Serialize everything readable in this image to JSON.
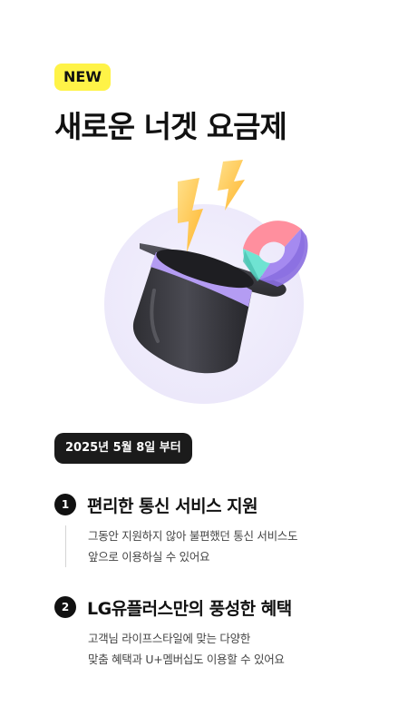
{
  "badge": "NEW",
  "title": "새로운 너겟 요금제",
  "hero": {
    "colors": {
      "circle": "#efecfb",
      "hat": "#3a3a40",
      "band": "#b49cf3",
      "bolt": "#ffc64a",
      "ring_pink": "#ff8f9e",
      "ring_mint": "#6fe3d2",
      "ring_purple": "#a58af0"
    }
  },
  "date_chip": "2025년 5월 8일 부터",
  "features": [
    {
      "number": "1",
      "title": "편리한 통신 서비스 지원",
      "lines": [
        "그동안 지원하지 않아 불편했던 통신 서비스도",
        "앞으로 이용하실 수 있어요"
      ]
    },
    {
      "number": "2",
      "title": "LG유플러스만의 풍성한 혜택",
      "lines": [
        "고객님 라이프스타일에 맞는 다양한",
        "맞춤 혜택과 U+멤버십도 이용할 수 있어요"
      ]
    }
  ]
}
